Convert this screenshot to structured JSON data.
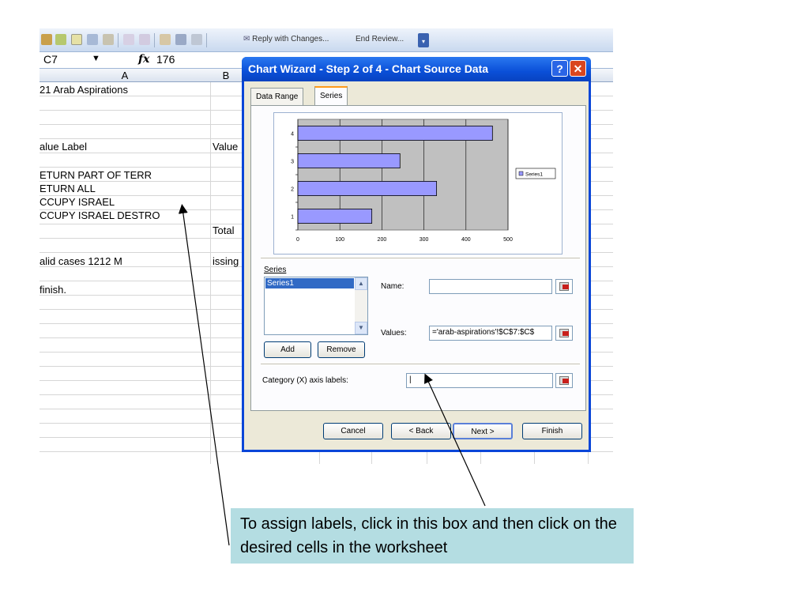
{
  "toolbar": {
    "reply_label": "Reply with Changes...",
    "end_review_label": "End Review..."
  },
  "formula_bar": {
    "cell_ref": "C7",
    "fx": "fx",
    "value": "176"
  },
  "sheet": {
    "columns": [
      "A",
      "B"
    ],
    "cells": {
      "r1": "21     Arab Aspirations",
      "value_label": "alue Label",
      "value_col": "Value",
      "row_1": "ETURN PART OF TERR",
      "row_2": "ETURN ALL",
      "row_3": "CCUPY ISRAEL",
      "row_4": "CCUPY ISRAEL DESTRO",
      "total": "Total",
      "valid": "alid cases    1212        M",
      "missing": "issing",
      "finish": "finish."
    }
  },
  "dialog": {
    "title": "Chart Wizard - Step 2 of 4 - Chart Source Data",
    "help_label": "?",
    "close_label": "✕",
    "tabs": [
      "Data Range",
      "Series"
    ],
    "series_label": "Series",
    "series_items": [
      "Series1"
    ],
    "name_label": "Name:",
    "name_value": "",
    "values_label": "Values:",
    "values_value": "='arab-aspirations'!$C$7:$C$",
    "add_label": "Add",
    "remove_label": "Remove",
    "category_label": "Category (X) axis labels:",
    "category_value": "|",
    "buttons": {
      "cancel": "Cancel",
      "back": "< Back",
      "next": "Next >",
      "finish": "Finish"
    }
  },
  "chart_data": {
    "type": "bar",
    "orientation": "horizontal",
    "categories": [
      "1",
      "2",
      "3",
      "4"
    ],
    "series": [
      {
        "name": "Series1",
        "values": [
          176,
          330,
          243,
          463
        ]
      }
    ],
    "xlim": [
      0,
      500
    ],
    "xticks": [
      "0",
      "100",
      "200",
      "300",
      "400",
      "500"
    ],
    "bar_color": "#9999ff",
    "plot_background": "#c0c0c0",
    "grid": true,
    "legend": "right"
  },
  "callout": {
    "text": "To assign labels, click in this box and then click on the desired cells in the worksheet"
  }
}
